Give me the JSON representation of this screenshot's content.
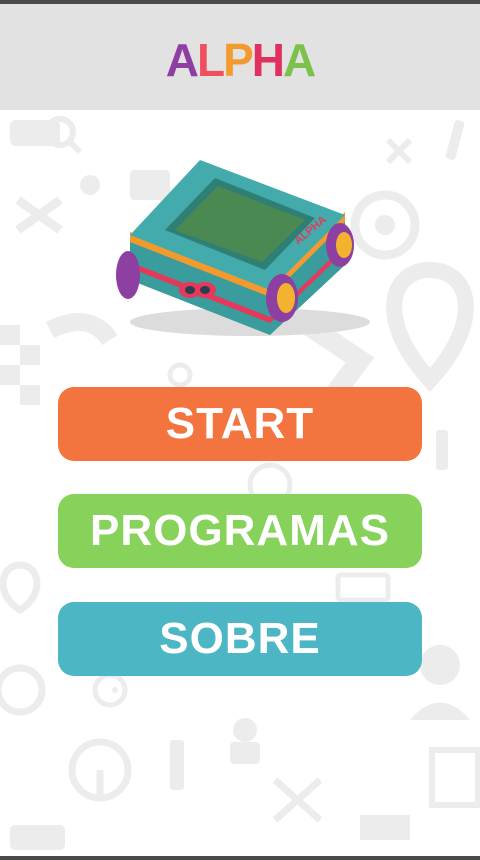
{
  "header": {
    "logo_letters": [
      {
        "char": "A",
        "color": "#8d3fa2"
      },
      {
        "char": "L",
        "color": "#f04f5e"
      },
      {
        "char": "P",
        "color": "#f39a2e"
      },
      {
        "char": "H",
        "color": "#e1305f"
      },
      {
        "char": "A",
        "color": "#7cc24a"
      }
    ]
  },
  "robot": {
    "body_color": "#3fa5a5",
    "band_color": "#f39a2e",
    "stripe_color": "#e5385a",
    "wheel_color": "#8d3fa2",
    "icon_name": "alpha-robot-illustration"
  },
  "menu": {
    "start_label": "START",
    "programas_label": "PROGRAMAS",
    "sobre_label": "SOBRE",
    "colors": {
      "start": "#f4743f",
      "programas": "#86d25a",
      "sobre": "#4db6c5"
    }
  },
  "background": {
    "icon_names": [
      "car-repair-icon",
      "wrench-icon",
      "gear-icon",
      "map-pin-icon",
      "steering-wheel-icon",
      "spark-plug-icon",
      "mechanic-icon",
      "tire-icon",
      "checkered-flag-icon",
      "road-icon",
      "dashboard-icon",
      "tools-icon"
    ],
    "icon_color": "#ececec"
  }
}
